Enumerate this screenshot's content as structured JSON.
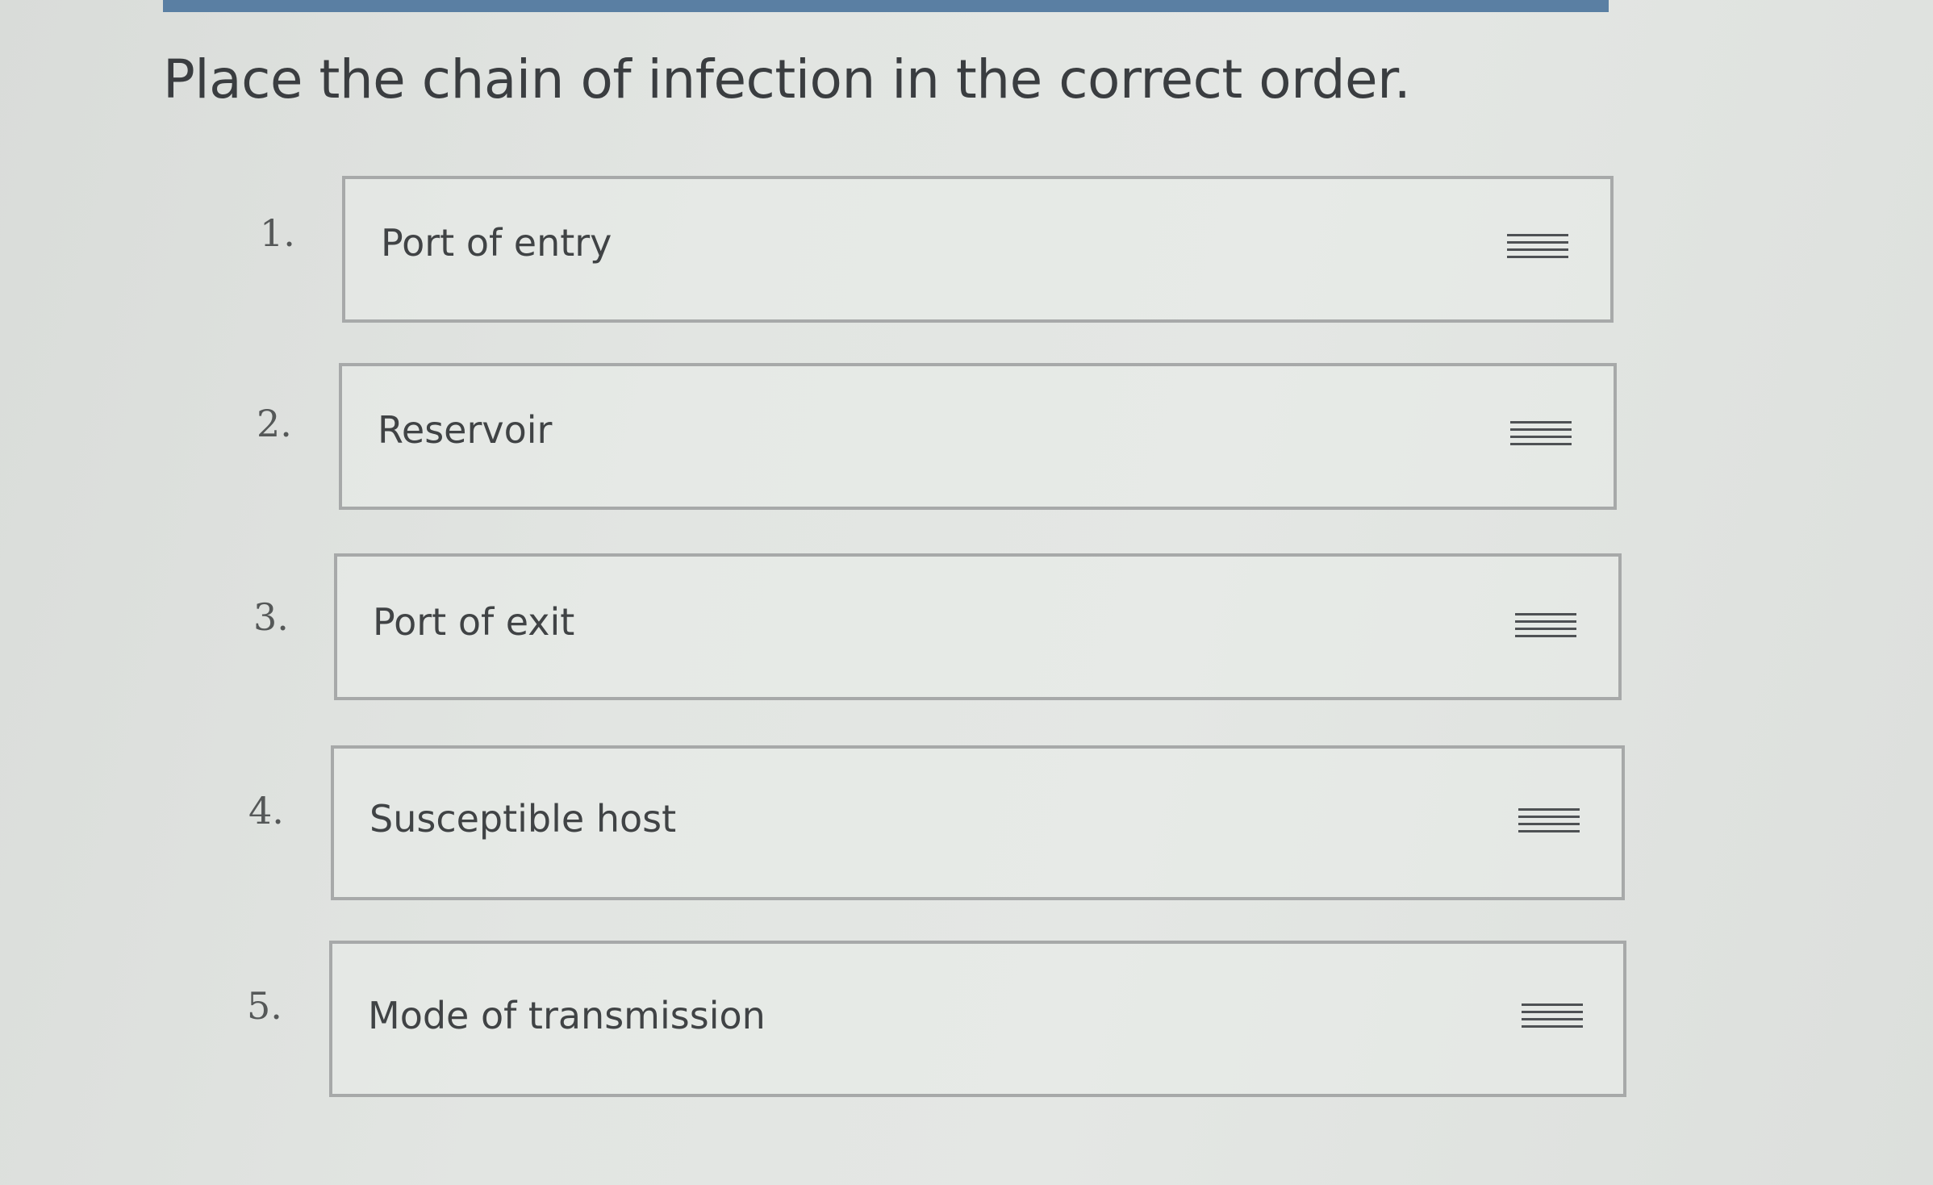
{
  "question": {
    "text": "Place the chain of infection in the correct order."
  },
  "order_list": {
    "items": [
      {
        "number": "1.",
        "label": "Port of entry",
        "handle_icon": "drag-handle-icon"
      },
      {
        "number": "2.",
        "label": "Reservoir",
        "handle_icon": "drag-handle-icon"
      },
      {
        "number": "3.",
        "label": "Port of exit",
        "handle_icon": "drag-handle-icon"
      },
      {
        "number": "4.",
        "label": "Susceptible host",
        "handle_icon": "drag-handle-icon"
      },
      {
        "number": "5.",
        "label": "Mode of transmission",
        "handle_icon": "drag-handle-icon"
      }
    ]
  },
  "colors": {
    "top_bar": "#5a7fa3",
    "card_border": "#a7a9a9",
    "text": "#404345"
  }
}
